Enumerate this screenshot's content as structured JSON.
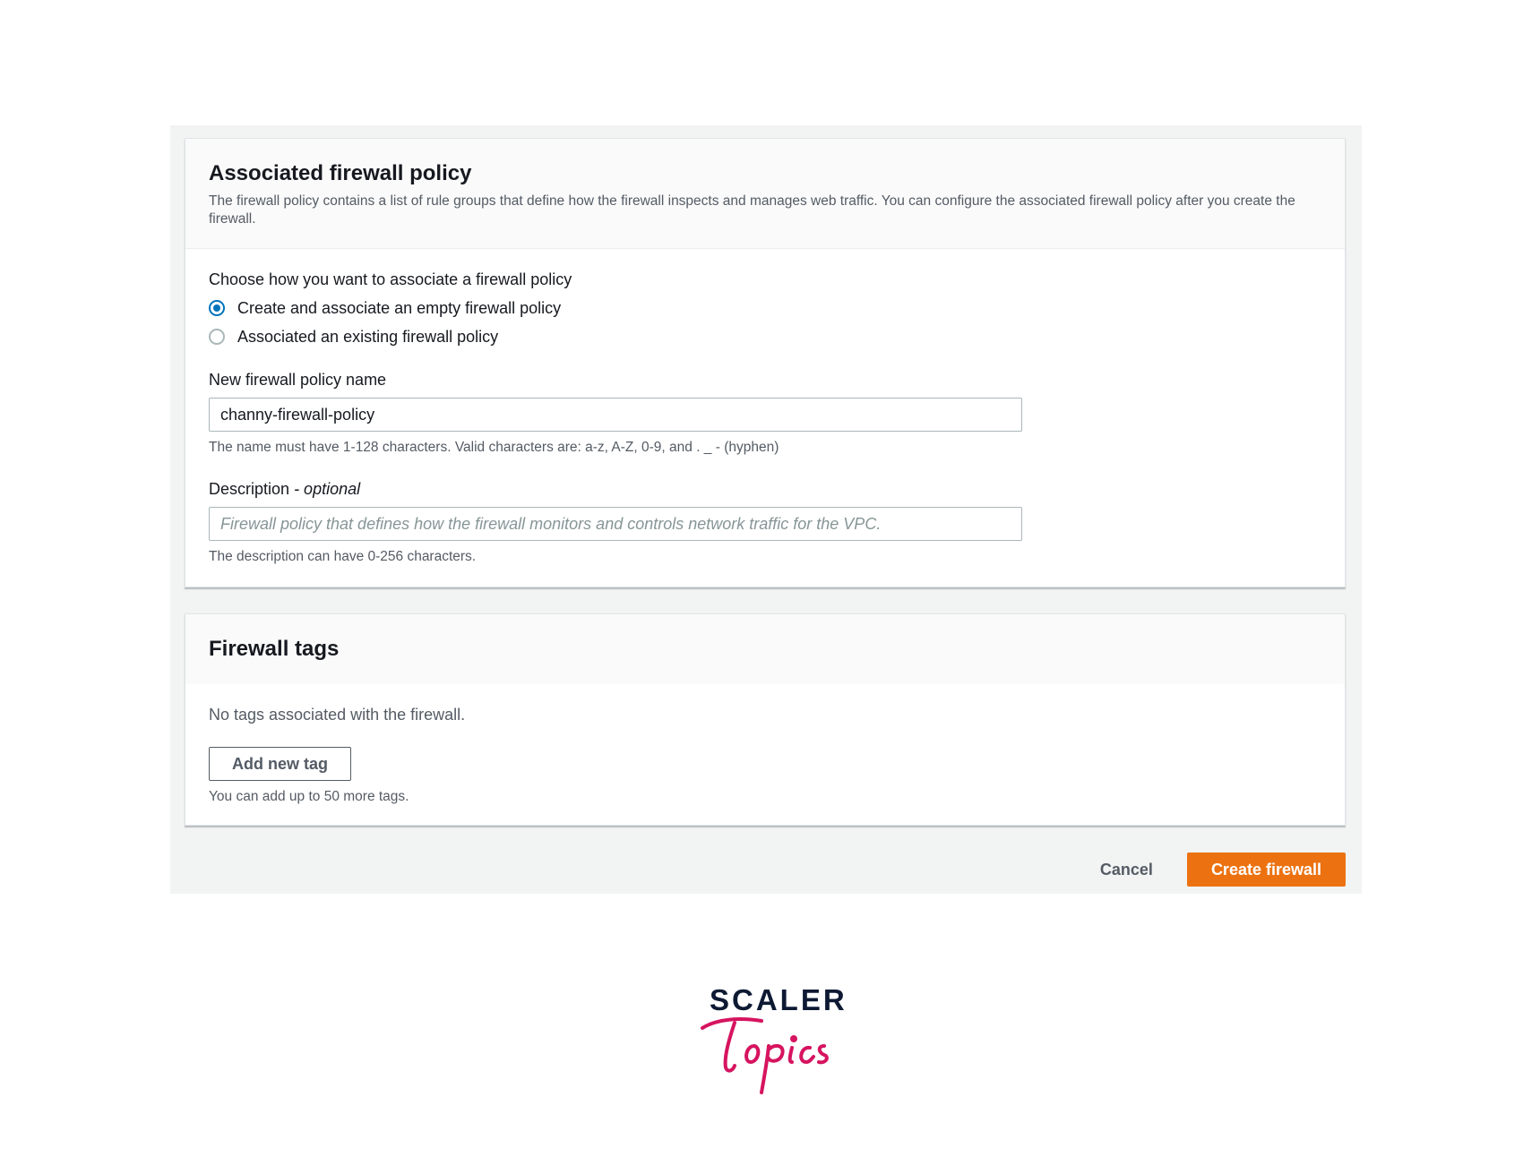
{
  "policy_section": {
    "title": "Associated firewall policy",
    "description": "The firewall policy contains a list of rule groups that define how the firewall inspects and manages web traffic. You can configure the associated firewall policy after you create the firewall.",
    "choose_label": "Choose how you want to associate a firewall policy",
    "options": [
      {
        "label": "Create and associate an empty firewall policy",
        "selected": true
      },
      {
        "label": "Associated an existing firewall policy",
        "selected": false
      }
    ],
    "name_field": {
      "label": "New firewall policy name",
      "value": "channy-firewall-policy",
      "hint": "The name must have 1-128 characters. Valid characters are: a-z, A-Z, 0-9, and . _ - (hyphen)"
    },
    "description_field": {
      "label": "Description",
      "label_suffix": "- optional",
      "value": "",
      "placeholder": "Firewall policy that defines how the firewall monitors and controls network traffic for the VPC.",
      "hint": "The description can have 0-256 characters."
    }
  },
  "tags_section": {
    "title": "Firewall tags",
    "empty_text": "No tags associated with the firewall.",
    "add_button": "Add new tag",
    "hint": "You can add up to 50 more tags."
  },
  "actions": {
    "cancel": "Cancel",
    "create": "Create firewall"
  },
  "logo": {
    "word": "SCALER",
    "script": "Topics"
  },
  "colors": {
    "primary": "#ec7211",
    "radio_selected": "#0073bb",
    "logo_dark": "#0e1a33",
    "logo_pink": "#d6145f"
  }
}
